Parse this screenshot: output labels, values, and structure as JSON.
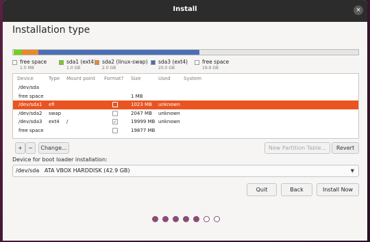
{
  "window": {
    "title": "Install",
    "close_glyph": "×"
  },
  "page_title": "Installation type",
  "disk_bar": {
    "segments": [
      {
        "name": "free space",
        "fraction": 0.0024,
        "color": "#f0f0f0"
      },
      {
        "name": "sda1",
        "fraction": 0.024,
        "color": "#73d216"
      },
      {
        "name": "sda2",
        "fraction": 0.048,
        "color": "#e9892b"
      },
      {
        "name": "sda3",
        "fraction": 0.466,
        "color": "#4a6fb5"
      },
      {
        "name": "free space",
        "fraction": 0.4596,
        "color": "#e6e6e6"
      }
    ]
  },
  "legend": [
    {
      "name": "free space",
      "size": "1.0 MB",
      "color": "#ffffff"
    },
    {
      "name": "sda1 (ext4)",
      "size": "1.0 GB",
      "color": "#73d216"
    },
    {
      "name": "sda2 (linux-swap)",
      "size": "2.0 GB",
      "color": "#e9892b"
    },
    {
      "name": "sda3 (ext4)",
      "size": "20.0 GB",
      "color": "#4a6fb5"
    },
    {
      "name": "free space",
      "size": "19.9 GB",
      "color": "#ffffff"
    }
  ],
  "table": {
    "headers": {
      "device": "Device",
      "type": "Type",
      "mount": "Mount point",
      "format": "Format?",
      "size": "Size",
      "used": "Used",
      "system": "System"
    },
    "rows": [
      {
        "device": "/dev/sda",
        "type": "",
        "mount": "",
        "format": null,
        "size": "",
        "used": "",
        "selected": false
      },
      {
        "device": "free space",
        "type": "",
        "mount": "",
        "format": null,
        "size": "1 MB",
        "used": "",
        "selected": false
      },
      {
        "device": "/dev/sda1",
        "type": "efi",
        "mount": "",
        "format": false,
        "size": "1023 MB",
        "used": "unknown",
        "selected": true
      },
      {
        "device": "/dev/sda2",
        "type": "swap",
        "mount": "",
        "format": false,
        "size": "2047 MB",
        "used": "unknown",
        "selected": false
      },
      {
        "device": "/dev/sda3",
        "type": "ext4",
        "mount": "/",
        "format": true,
        "size": "19999 MB",
        "used": "unknown",
        "selected": false
      },
      {
        "device": "free space",
        "type": "",
        "mount": "",
        "format": false,
        "size": "19877 MB",
        "used": "",
        "selected": false
      }
    ]
  },
  "toolbar": {
    "add_label": "+",
    "remove_label": "−",
    "change_label": "Change...",
    "new_table_label": "New Partition Table...",
    "revert_label": "Revert"
  },
  "boot": {
    "label": "Device for boot loader installation:",
    "selected": "/dev/sda   ATA VBOX HARDDISK (42.9 GB)"
  },
  "buttons": {
    "quit": "Quit",
    "back": "Back",
    "install_now": "Install Now"
  },
  "progress": {
    "total_steps": 7,
    "completed_steps": 5
  },
  "colors": {
    "accent": "#e95420",
    "step_done": "#8a4b74",
    "titlebar": "#2c2c2c"
  }
}
